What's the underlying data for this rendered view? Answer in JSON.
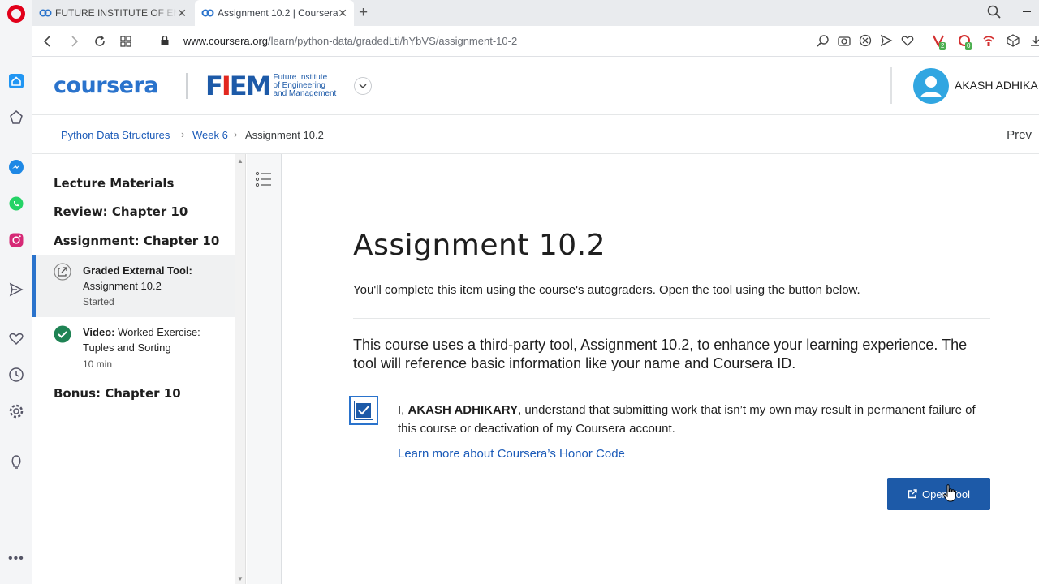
{
  "browser": {
    "tabs": [
      {
        "title": "FUTURE INSTITUTE OF ENGI",
        "active": false
      },
      {
        "title": "Assignment 10.2 | Coursera",
        "active": true
      }
    ],
    "url_domain": "www.coursera.org",
    "url_path": "/learn/python-data/gradedLti/hYbVS/assignment-10-2",
    "extension_badges": [
      "2",
      "0"
    ]
  },
  "header": {
    "logo_text": "coursera",
    "partner_mark": "FIEM",
    "partner_name_lines": [
      "Future Institute",
      "of Engineering",
      "and Management"
    ],
    "user_name": "AKASH ADHIKA"
  },
  "breadcrumb": {
    "items": [
      "Python Data Structures",
      "Week 6",
      "Assignment 10.2"
    ],
    "prev_label": "Prev"
  },
  "sidebar": {
    "sections": [
      "Lecture Materials",
      "Review: Chapter 10",
      "Assignment: Chapter 10",
      "Bonus: Chapter 10"
    ],
    "items": [
      {
        "type_label": "Graded External Tool:",
        "title": "Assignment 10.2",
        "status": "Started",
        "active": true
      },
      {
        "type_label": "Video:",
        "title": "Worked Exercise: Tuples and Sorting",
        "status": "10 min",
        "completed": true
      }
    ]
  },
  "main": {
    "title": "Assignment 10.2",
    "intro": "You'll complete this item using the course's autograders. Open the tool using the button below.",
    "notice": "This course uses a third-party tool, Assignment 10.2, to enhance your learning experience. The tool will reference basic information like your name and Coursera ID.",
    "honor_prefix": "I, ",
    "honor_name": "AKASH ADHIKARY",
    "honor_suffix": ", understand that submitting work that isn’t my own may result in permanent failure of this course or deactivation of my Coursera account.",
    "honor_checked": true,
    "honor_link": "Learn more about Coursera’s Honor Code",
    "open_button": "Open Tool"
  },
  "colors": {
    "brand_blue": "#2a73cc",
    "button_blue": "#1d5aa8",
    "link_blue": "#1a5ab8",
    "success_green": "#1f8354",
    "opera_red": "#e2001a"
  }
}
